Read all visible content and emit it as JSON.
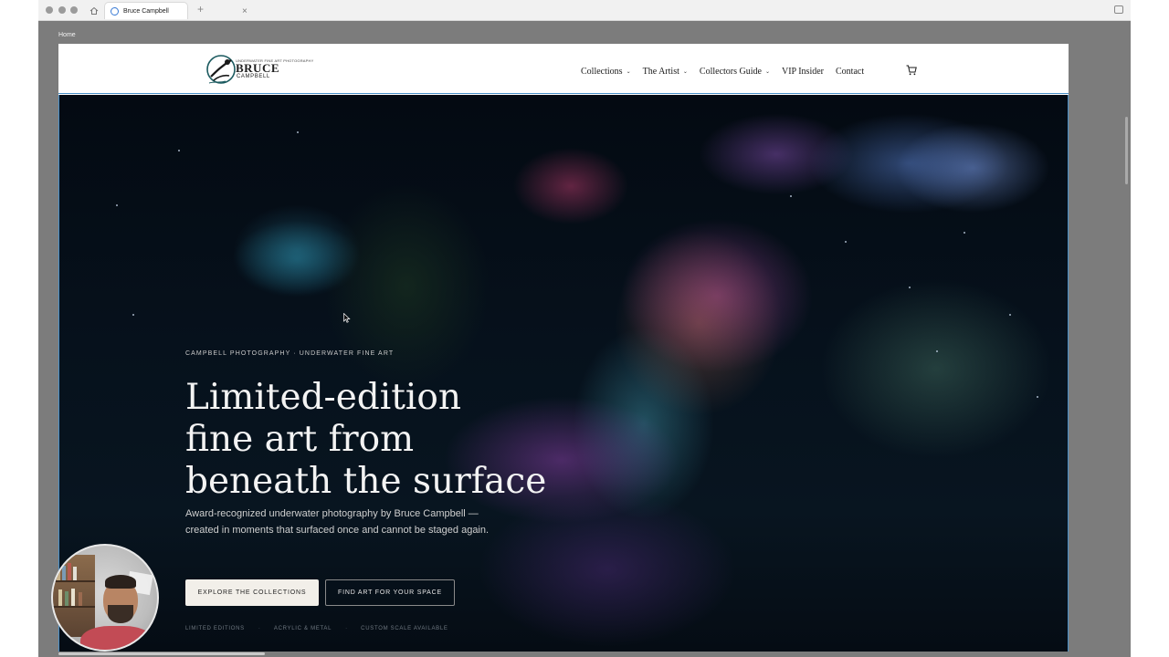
{
  "browser": {
    "tab_title": "Bruce Campbell",
    "new_tab_glyph": "+",
    "close_glyph": "×"
  },
  "breadcrumb": "Home",
  "site": {
    "logo": {
      "small_text": "UNDERWATER FINE ART PHOTOGRAPHY",
      "name": "BRUCE",
      "surname": "CAMPBELL"
    },
    "nav": [
      {
        "label": "Collections",
        "has_dropdown": true
      },
      {
        "label": "The Artist",
        "has_dropdown": true
      },
      {
        "label": "Collectors Guide",
        "has_dropdown": true
      },
      {
        "label": "VIP Insider",
        "has_dropdown": false
      },
      {
        "label": "Contact",
        "has_dropdown": false
      }
    ],
    "cart_icon": "cart-icon"
  },
  "hero": {
    "eyebrow": "CAMPBELL PHOTOGRAPHY · UNDERWATER FINE ART",
    "headline": [
      "Limited-edition",
      "fine art from",
      "beneath the surface"
    ],
    "subline": [
      "Award-recognized underwater photography by Bruce Campbell —",
      "created in moments that surfaced once and cannot be staged again."
    ],
    "primary_button": "EXPLORE THE COLLECTIONS",
    "secondary_button": "FIND ART FOR YOUR SPACE",
    "features": [
      "LIMITED EDITIONS",
      "ACRYLIC & METAL",
      "CUSTOM SCALE AVAILABLE"
    ],
    "feature_separator": "·"
  },
  "colors": {
    "header_border": "#4a90c8",
    "button_primary_bg": "#f2efe9",
    "hero_bg": "#06111c"
  }
}
